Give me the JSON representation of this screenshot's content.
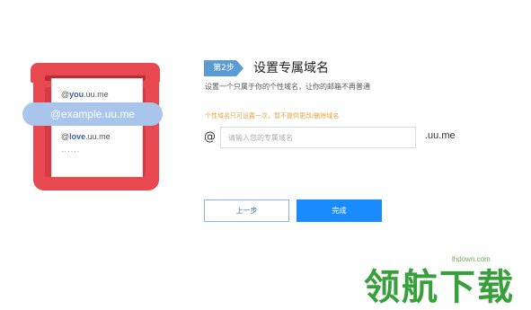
{
  "illustration": {
    "line1_prefix": "@",
    "line1_bold": "you",
    "line1_suffix": ".uu.me",
    "pill": "@example.uu.me",
    "line3_prefix": "@",
    "line3_bold": "love",
    "line3_suffix": ".uu.me",
    "dots": "......"
  },
  "step": {
    "badge": "第2步",
    "title": "设置专属域名",
    "description": "设置一个只属于你的个性域名，让你的邮箱不再普通",
    "note": "个性域名只可设置一次，暂不提供更改/删除域名"
  },
  "form": {
    "at": "@",
    "placeholder": "请输入您的专属域名",
    "suffix": ".uu.me"
  },
  "buttons": {
    "prev": "上一步",
    "done": "完成"
  },
  "watermark": {
    "site": "lhdown.com",
    "text": "领航下载"
  },
  "colors": {
    "mailbox_red": "#e8484f",
    "pill_blue": "#a9c5ec",
    "badge_blue": "#5b9bd5",
    "primary_blue": "#1a8cff",
    "note_orange": "#e6a23c",
    "watermark_green": "#37a03b"
  }
}
